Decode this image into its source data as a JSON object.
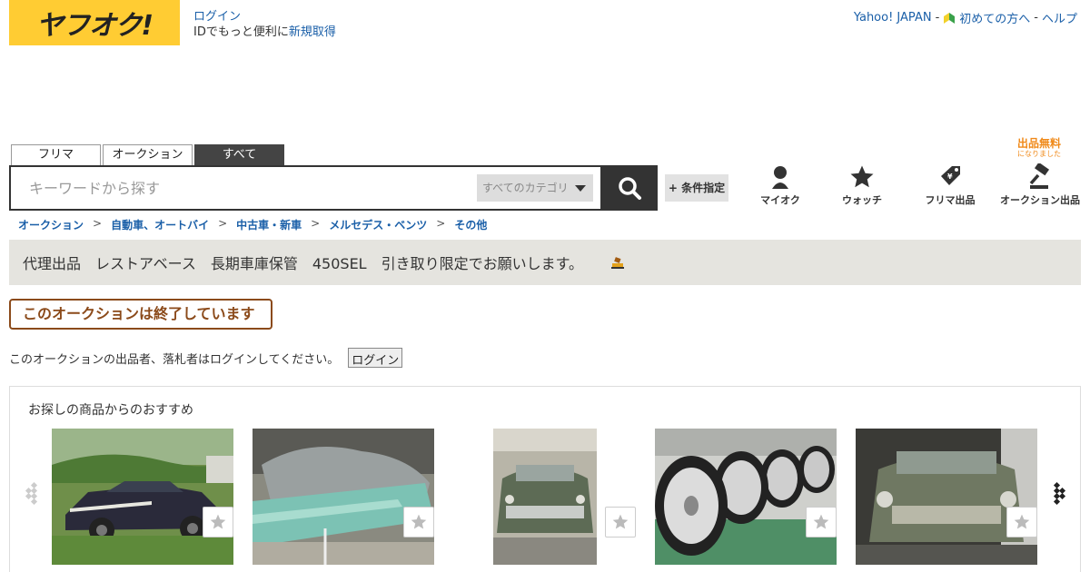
{
  "header": {
    "logo": "ヤフオク!",
    "login_link": "ログイン",
    "login_sub_prefix": "IDでもっと便利に",
    "signup_link": "新規取得",
    "top_links": [
      "Yahoo! JAPAN",
      "初めての方へ",
      "ヘルプ"
    ],
    "separator": "-"
  },
  "tabs": [
    {
      "label": "フリマ",
      "active": false
    },
    {
      "label": "オークション",
      "active": false
    },
    {
      "label": "すべて",
      "active": true
    }
  ],
  "search": {
    "placeholder": "キーワードから探す",
    "category": "すべてのカテゴリ",
    "condition_button": "+ 条件指定"
  },
  "nav_icons": [
    {
      "label": "マイオク",
      "icon": "person-icon"
    },
    {
      "label": "ウォッチ",
      "icon": "star-icon"
    },
    {
      "label": "フリマ出品",
      "icon": "price-tag-icon"
    },
    {
      "label": "オークション出品",
      "icon": "gavel-icon"
    }
  ],
  "free_note": {
    "title": "出品無料",
    "sub": "になりました"
  },
  "breadcrumb": [
    "オークション",
    "自動車、オートバイ",
    "中古車・新車",
    "メルセデス・ベンツ",
    "その他"
  ],
  "breadcrumb_sep": ">",
  "item": {
    "title": "代理出品　レストアベース　長期車庫保管　450SEL　引き取り限定でお願いします。",
    "status": "このオークションは終了しています",
    "login_message": "このオークションの出品者、落札者はログインしてください。",
    "login_button": "ログイン"
  },
  "recommend": {
    "title": "お探しの商品からのおすすめ",
    "items": [
      {
        "name": "rec-item-1"
      },
      {
        "name": "rec-item-2"
      },
      {
        "name": "rec-item-3"
      },
      {
        "name": "rec-item-4"
      },
      {
        "name": "rec-item-5"
      }
    ]
  },
  "colors": {
    "brand_yellow": "#ffcc33",
    "link": "#1a5fa8",
    "ended_border": "#8b4a1a",
    "free_orange": "#f08a1a",
    "title_bg": "#e5e4df"
  }
}
